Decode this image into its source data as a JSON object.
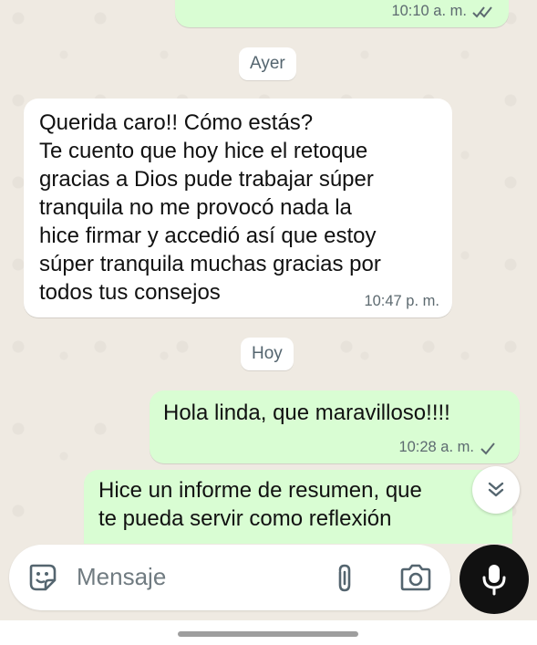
{
  "colors": {
    "outgoing_bubble": "#d9fdd3",
    "incoming_bubble": "#ffffff",
    "chat_background": "#efeae2",
    "read_ticks": "#5d6a70",
    "mic_button": "#111111"
  },
  "messages": [
    {
      "direction": "outgoing",
      "text": "",
      "time": "10:10 a. m.",
      "status_icon": "double-check-icon"
    },
    {
      "direction": "incoming",
      "text": "Querida caro!! Cómo estás?\nTe cuento que hoy hice el retoque\ngracias a Dios pude trabajar súper\ntranquila no me provocó nada la\nhice firmar y accedió así que estoy\nsúper tranquila muchas gracias por\ntodos tus consejos",
      "time": "10:47 p. m."
    },
    {
      "direction": "outgoing",
      "text": "Hola linda, que maravilloso!!!!",
      "time": "10:28 a. m.",
      "status_icon": "single-check-icon"
    },
    {
      "direction": "outgoing",
      "text": "Hice un informe de resumen, que\nte pueda servir como reflexión",
      "time": ""
    }
  ],
  "date_separators": [
    "Ayer",
    "Hoy"
  ],
  "input": {
    "placeholder": "Mensaje",
    "emoji_icon": "emoji-icon",
    "attach_icon": "paperclip-icon",
    "camera_icon": "camera-icon",
    "mic_icon": "microphone-icon"
  },
  "scroll_button_icon": "chevron-double-down-icon"
}
